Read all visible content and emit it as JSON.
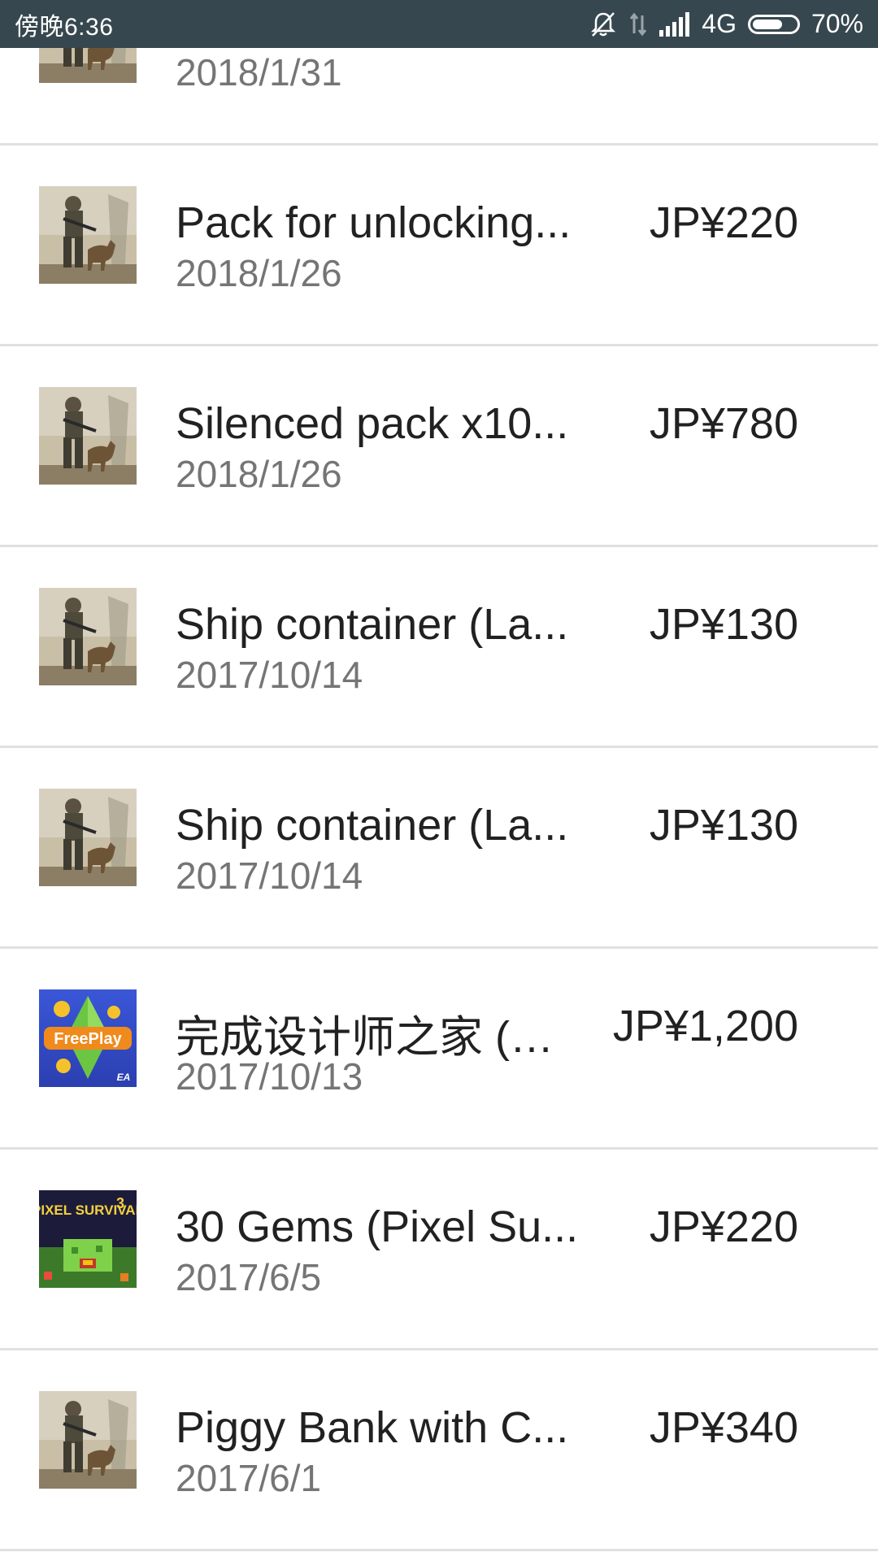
{
  "status_bar": {
    "time": "傍晚6:36",
    "network": "4G",
    "battery_percent": "70%",
    "battery_level": 0.7,
    "icons": [
      "bell-off-icon",
      "data-transfer-icon",
      "signal-icon",
      "battery-icon"
    ]
  },
  "colors": {
    "status_bar_bg": "#37474f",
    "divider": "#e0e0e0",
    "title_text": "#212121",
    "date_text": "#757575"
  },
  "purchases": [
    {
      "title": "",
      "date": "2018/1/31",
      "price": "",
      "icon": "soldier-dog-game-icon"
    },
    {
      "title": "Pack for unlocking...",
      "date": "2018/1/26",
      "price": "JP¥220",
      "icon": "soldier-dog-game-icon"
    },
    {
      "title": "Silenced pack x10...",
      "date": "2018/1/26",
      "price": "JP¥780",
      "icon": "soldier-dog-game-icon"
    },
    {
      "title": "Ship container (La...",
      "date": "2017/10/14",
      "price": "JP¥130",
      "icon": "soldier-dog-game-icon"
    },
    {
      "title": "Ship container (La...",
      "date": "2017/10/14",
      "price": "JP¥130",
      "icon": "soldier-dog-game-icon"
    },
    {
      "title": "完成设计师之家 (…",
      "date": "2017/10/13",
      "price": "JP¥1,200",
      "icon": "freeplay-game-icon",
      "icon_text": "FreePlay",
      "icon_sub": "EA"
    },
    {
      "title": "30 Gems (Pixel Su...",
      "date": "2017/6/5",
      "price": "JP¥220",
      "icon": "pixel-survival-game-icon",
      "icon_text": "PIXEL SURVIVAL",
      "icon_sub": "3"
    },
    {
      "title": "Piggy Bank with C...",
      "date": "2017/6/1",
      "price": "JP¥340",
      "icon": "soldier-dog-game-icon"
    }
  ]
}
